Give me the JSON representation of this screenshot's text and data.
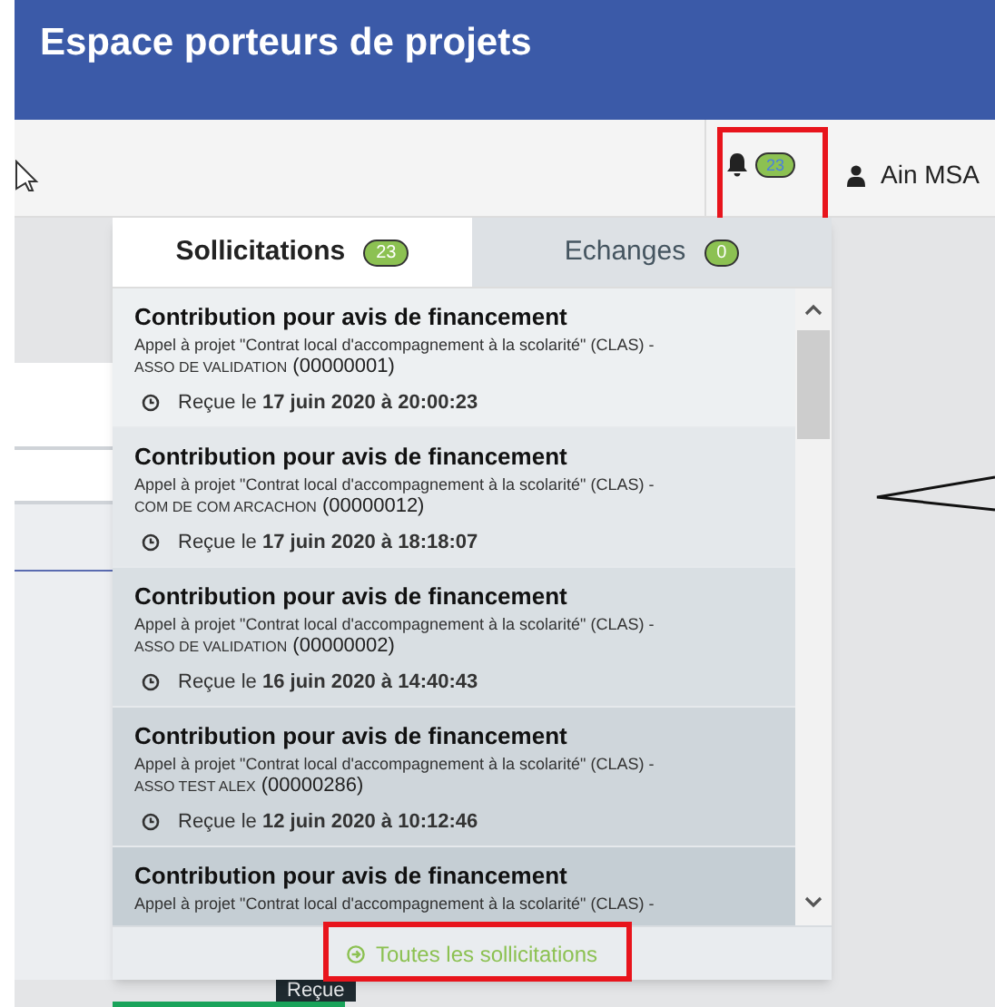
{
  "header": {
    "title": "Espace porteurs de projets"
  },
  "toolbar": {
    "notifications": {
      "count": "23",
      "highlighted": true
    },
    "user": {
      "name": "Ain MSA"
    }
  },
  "tabs": [
    {
      "label": "Sollicitations",
      "count": "23",
      "selected": true
    },
    {
      "label": "Echanges",
      "count": "0",
      "selected": false
    }
  ],
  "items": [
    {
      "title": "Contribution pour avis de financement",
      "call": "Appel à projet \"Contrat local d'accompagnement à la scolarité\" (CLAS) -",
      "org": "ASSO DE VALIDATION",
      "ref": "(00000001)",
      "received": "Reçue le **17 juin 2020 à 20:00:23**"
    },
    {
      "title": "Contribution pour avis de financement",
      "call": "Appel à projet \"Contrat local d'accompagnement à la scolarité\" (CLAS) -",
      "org": "COM DE COM ARCACHON",
      "ref": "(00000012)",
      "received": "Reçue le **17 juin 2020 à 18:18:07**"
    },
    {
      "title": "Contribution pour avis de financement",
      "call": "Appel à projet \"Contrat local d'accompagnement à la scolarité\" (CLAS) -",
      "org": "ASSO DE VALIDATION",
      "ref": "(00000002)",
      "received": "Reçue le **16 juin 2020 à 14:40:43**"
    },
    {
      "title": "Contribution pour avis de financement",
      "call": "Appel à projet \"Contrat local d'accompagnement à la scolarité\" (CLAS) -",
      "org": "ASSO TEST ALEX",
      "ref": "(00000286)",
      "received": "Reçue le **12 juin 2020 à 10:12:46**"
    },
    {
      "title": "Contribution pour avis de financement",
      "call": "Appel à projet \"Contrat local d'accompagnement à la scolarité\" (CLAS) -"
    }
  ],
  "footer_link": {
    "label": "Toutes les sollicitations",
    "highlighted": true
  },
  "background": {
    "status_label": "Reçue"
  }
}
